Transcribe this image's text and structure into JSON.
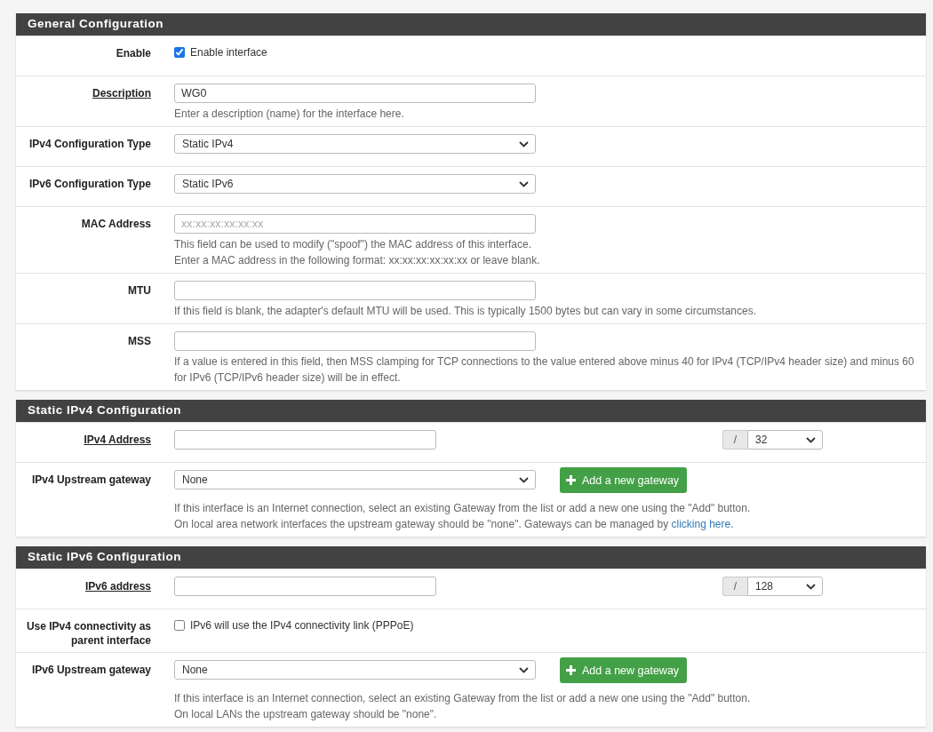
{
  "sections": [
    {
      "title": "General Configuration",
      "rows": [
        {
          "kind": "checkbox",
          "label": "Enable",
          "required": false,
          "checked": true,
          "text": "Enable interface"
        },
        {
          "kind": "text",
          "label": "Description",
          "required": true,
          "value": "WG0",
          "help": [
            {
              "text": "Enter a description (name) for the interface here."
            }
          ]
        },
        {
          "kind": "select",
          "label": "IPv4 Configuration Type",
          "required": false,
          "value": "Static IPv4"
        },
        {
          "kind": "select",
          "label": "IPv6 Configuration Type",
          "required": false,
          "value": "Static IPv6"
        },
        {
          "kind": "text",
          "label": "MAC Address",
          "required": false,
          "placeholder": "xx:xx:xx:xx:xx:xx",
          "help": [
            {
              "text": "This field can be used to modify (\"spoof\") the MAC address of this interface."
            },
            {
              "text": "Enter a MAC address in the following format: xx:xx:xx:xx:xx:xx or leave blank."
            }
          ]
        },
        {
          "kind": "text",
          "label": "MTU",
          "required": false,
          "help": [
            {
              "text": "If this field is blank, the adapter's default MTU will be used. This is typically 1500 bytes but can vary in some circumstances."
            }
          ]
        },
        {
          "kind": "text",
          "label": "MSS",
          "required": false,
          "help": [
            {
              "text": "If a value is entered in this field, then MSS clamping for TCP connections to the value entered above minus 40 for IPv4 (TCP/IPv4 header size) and minus 60 for IPv6 (TCP/IPv6 header size) will be in effect."
            }
          ]
        }
      ]
    },
    {
      "title": "Static IPv4 Configuration",
      "rows": [
        {
          "kind": "address",
          "label": "IPv4 Address",
          "required": true,
          "separator": "/",
          "mask": "32"
        },
        {
          "kind": "gateway",
          "label": "IPv4 Upstream gateway",
          "required": false,
          "value": "None",
          "button": "Add a new gateway",
          "help": [
            {
              "text": "If this interface is an Internet connection, select an existing Gateway from the list or add a new one using the \"Add\" button."
            },
            {
              "text": "On local area network interfaces the upstream gateway should be \"none\". Gateways can be managed by ",
              "link": "clicking here",
              "after": "."
            }
          ]
        }
      ]
    },
    {
      "title": "Static IPv6 Configuration",
      "rows": [
        {
          "kind": "address",
          "label": "IPv6 address",
          "required": true,
          "separator": "/",
          "mask": "128"
        },
        {
          "kind": "checkbox",
          "label": "Use IPv4 connectivity as parent interface",
          "required": false,
          "checked": false,
          "text": "IPv6 will use the IPv4 connectivity link (PPPoE)"
        },
        {
          "kind": "gateway",
          "label": "IPv6 Upstream gateway",
          "required": false,
          "value": "None",
          "button": "Add a new gateway",
          "help": [
            {
              "text": "If this interface is an Internet connection, select an existing Gateway from the list or add a new one using the \"Add\" button."
            },
            {
              "text": "On local LANs the upstream gateway should be \"none\"."
            }
          ]
        }
      ]
    }
  ]
}
